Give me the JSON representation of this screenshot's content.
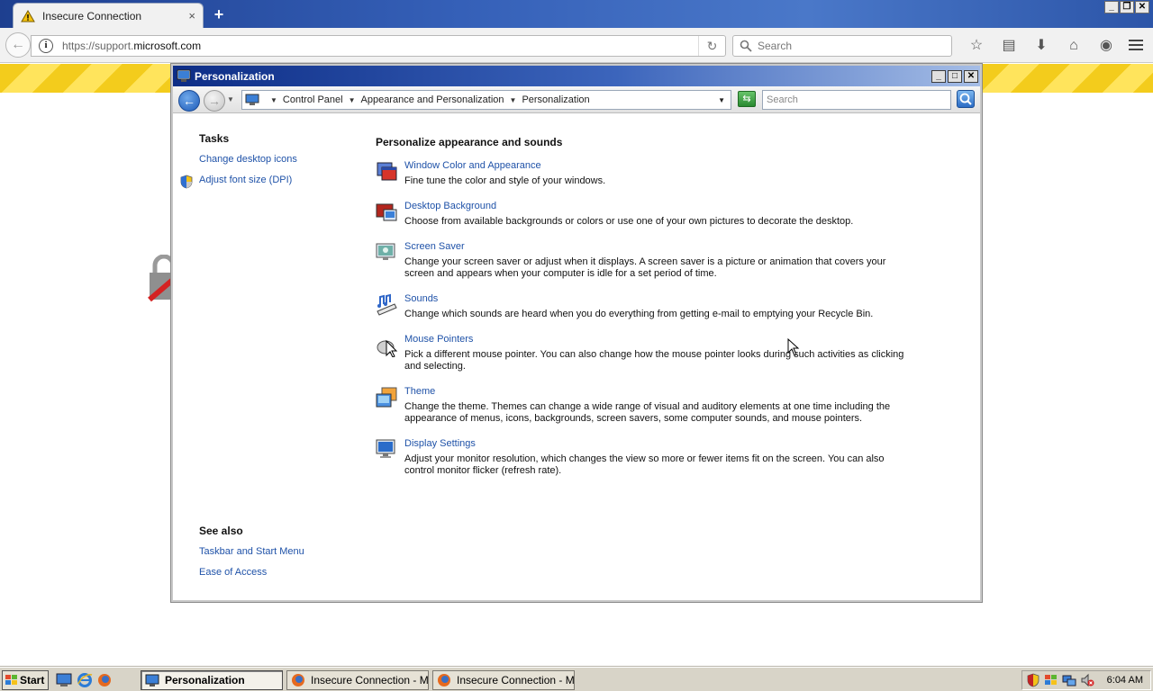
{
  "browser": {
    "tab_title": "Insecure Connection",
    "tab_close": "×",
    "new_tab": "+",
    "url_prefix": "https://support.",
    "url_host": "microsoft.com",
    "search_placeholder": "Search",
    "window_controls": [
      "_",
      "❐",
      "✕"
    ]
  },
  "window": {
    "title": "Personalization",
    "controls": [
      "_",
      "□",
      "✕"
    ],
    "breadcrumb": [
      "Control Panel",
      "Appearance and Personalization",
      "Personalization"
    ],
    "search_placeholder": "Search"
  },
  "tasks": {
    "heading": "Tasks",
    "links": [
      "Change desktop icons",
      "Adjust font size (DPI)"
    ]
  },
  "see_also": {
    "heading": "See also",
    "links": [
      "Taskbar and Start Menu",
      "Ease of Access"
    ]
  },
  "main": {
    "heading": "Personalize appearance and sounds",
    "items": [
      {
        "title": "Window Color and Appearance",
        "desc": "Fine tune the color and style of your windows.",
        "icon": "window-color-icon"
      },
      {
        "title": "Desktop Background",
        "desc": "Choose from available backgrounds or colors or use one of your own pictures to decorate the desktop.",
        "icon": "desktop-background-icon"
      },
      {
        "title": "Screen Saver",
        "desc": "Change your screen saver or adjust when it displays. A screen saver is a picture or animation that covers your screen and appears when your computer is idle for a set period of time.",
        "icon": "screen-saver-icon"
      },
      {
        "title": "Sounds",
        "desc": "Change which sounds are heard when you do everything from getting e-mail to emptying your Recycle Bin.",
        "icon": "sounds-icon"
      },
      {
        "title": "Mouse Pointers",
        "desc": "Pick a different mouse pointer. You can also change how the mouse pointer looks during such activities as clicking and selecting.",
        "icon": "mouse-pointers-icon"
      },
      {
        "title": "Theme",
        "desc": "Change the theme. Themes can change a wide range of visual and auditory elements at one time including the appearance of menus, icons, backgrounds, screen savers, some computer sounds, and mouse pointers.",
        "icon": "theme-icon"
      },
      {
        "title": "Display Settings",
        "desc": "Adjust your monitor resolution, which changes the view so more or fewer items fit on the screen. You can also control monitor flicker (refresh rate).",
        "icon": "display-settings-icon"
      }
    ]
  },
  "taskbar": {
    "start_label": "Start",
    "tasks": [
      "Personalization",
      "Insecure Connection - M...",
      "Insecure Connection - M..."
    ],
    "clock": "6:04 AM"
  },
  "colors": {
    "link": "#1f52a8",
    "titlebar_start": "#0d2d86",
    "warning_stripe": "#f3cc1c"
  }
}
